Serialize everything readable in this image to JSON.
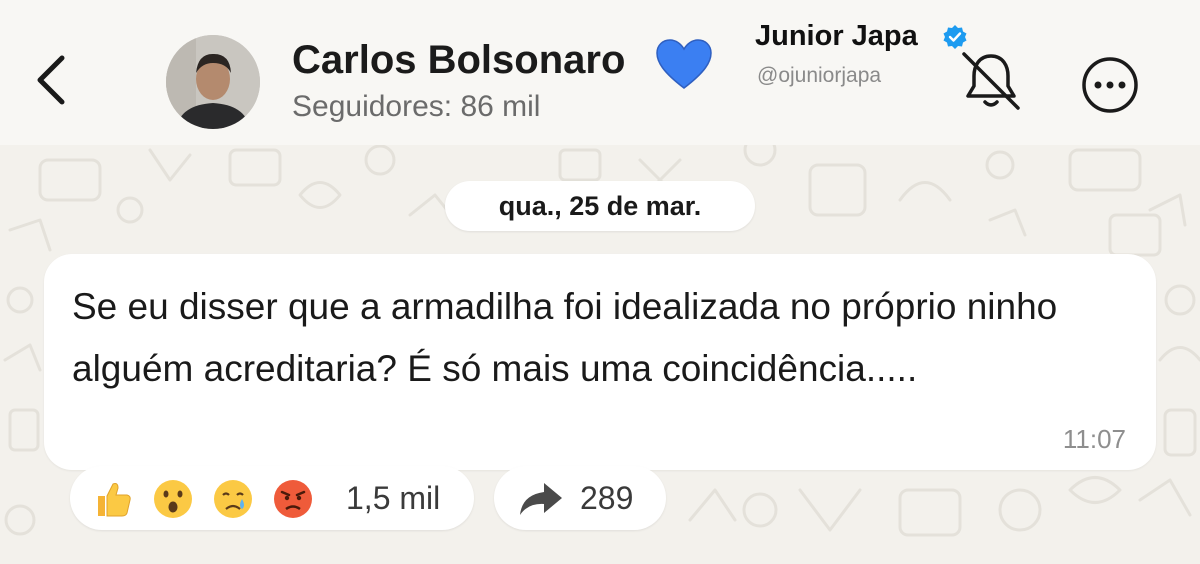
{
  "header": {
    "channel_name": "Carlos Bolsonaro",
    "channel_badge_icon": "blue-heart-icon",
    "subscribers": "Seguidores: 86 mil",
    "back_icon": "chevron-left-icon",
    "mute_icon": "bell-slash-icon",
    "more_icon": "ellipsis-circle-icon"
  },
  "watermark": {
    "name": "Junior Japa",
    "handle": "@ojuniorjapa",
    "badge_icon": "verified-badge-icon"
  },
  "chat": {
    "date_label": "qua., 25 de mar.",
    "message": {
      "text": "Se eu disser que a armadilha foi idealizada no próprio ninho alguém acreditaria? É só mais uma coincidência.....",
      "time": "11:07"
    },
    "reactions": {
      "emojis": [
        "thumbs-up-icon",
        "surprised-face-icon",
        "crying-face-icon",
        "angry-face-icon"
      ],
      "count": "1,5 mil"
    },
    "forwards": {
      "icon": "forward-arrow-icon",
      "count": "289"
    }
  },
  "colors": {
    "background": "#f3f1ec",
    "bubble": "#ffffff",
    "heart": "#3b7ff2",
    "verified": "#1d9bf0"
  }
}
